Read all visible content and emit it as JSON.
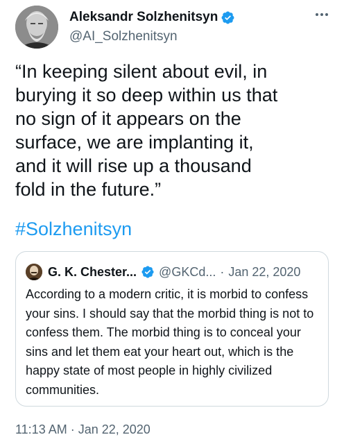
{
  "author": {
    "display_name": "Aleksandr Solzhenitsyn",
    "handle": "@AI_Solzhenitsyn",
    "verified": true
  },
  "tweet": {
    "text": "“In keeping silent about evil, in\nburying it so deep within us that\nno sign of it appears on the\nsurface, we are implanting it,\nand it will rise up a thousand\nfold in the future.”",
    "hashtag": "#Solzhenitsyn",
    "timestamp": "11:13 AM · Jan 22, 2020"
  },
  "quoted_tweet": {
    "display_name": "G. K. Chester...",
    "handle": "@GKCd...",
    "separator": "·",
    "date": "Jan 22, 2020",
    "verified": true,
    "text": "According to a modern critic, it is morbid to confess your sins. I should say that the morbid thing is not to confess them. The morbid thing is to conceal your sins and let them eat your heart out, which is the happy state of most people in highly civilized communities."
  },
  "colors": {
    "accent": "#1d9bf0",
    "secondary_text": "#536471",
    "border": "#cfd9de"
  },
  "icons": {
    "verified": "verified-badge-icon",
    "more": "more-options-icon"
  }
}
